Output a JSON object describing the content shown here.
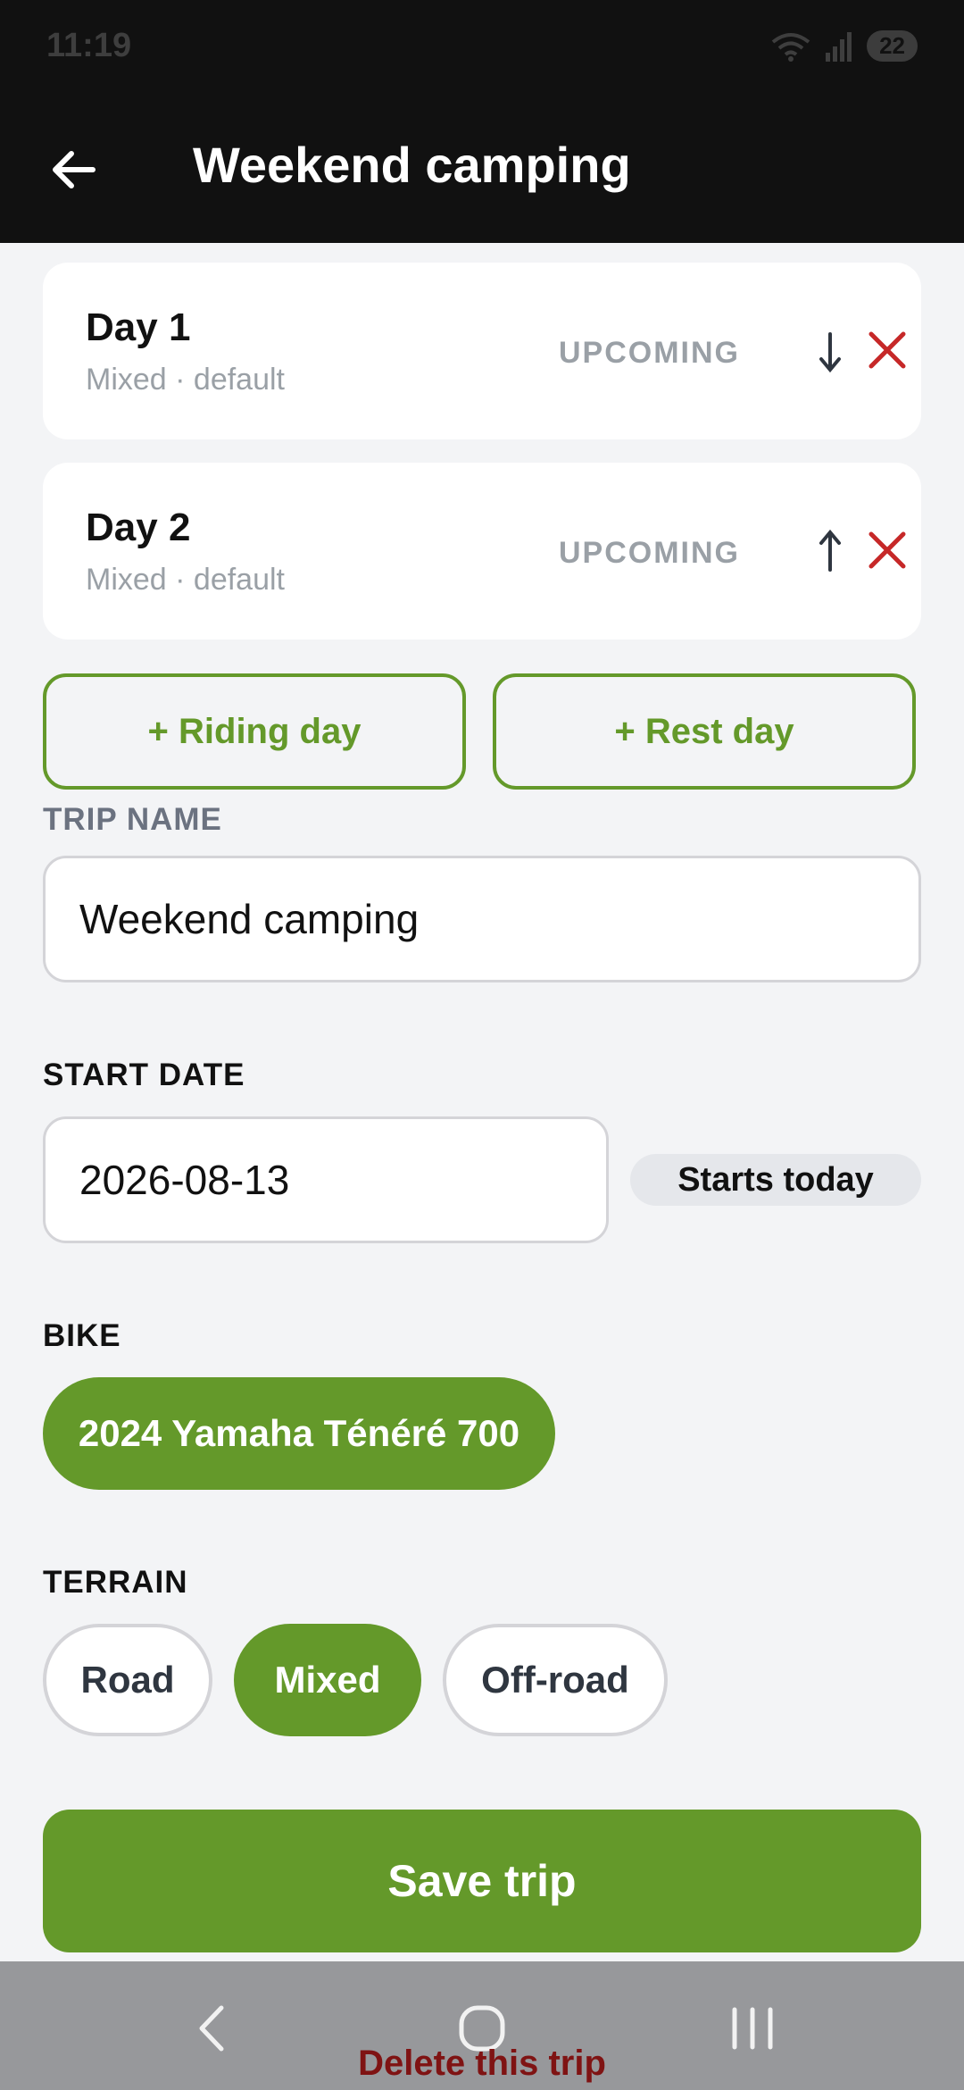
{
  "status_bar": {
    "time": "11:19",
    "battery": "22",
    "wifi_icon": "wifi-icon",
    "signal_icon": "signal-icon"
  },
  "header": {
    "title": "Weekend camping",
    "back_icon": "back-arrow-icon"
  },
  "days": [
    {
      "title": "Day 1",
      "subtitle": "Mixed · default",
      "status": "UPCOMING",
      "move_icon": "arrow-down-icon"
    },
    {
      "title": "Day 2",
      "subtitle": "Mixed · default",
      "status": "UPCOMING",
      "move_icon": "arrow-up-icon"
    }
  ],
  "add_buttons": {
    "riding_day": "+ Riding day",
    "rest_day": "+ Rest day"
  },
  "trip_name": {
    "label": "TRIP NAME",
    "value": "Weekend camping"
  },
  "start_date": {
    "label": "START DATE",
    "value": "2026-08-13",
    "badge": "Starts today"
  },
  "bike": {
    "label": "BIKE",
    "selected": "2024 Yamaha Ténéré 700"
  },
  "terrain": {
    "label": "TERRAIN",
    "options": [
      "Road",
      "Mixed",
      "Off-road"
    ],
    "selected": "Mixed"
  },
  "actions": {
    "save": "Save trip",
    "delete": "Delete this trip"
  },
  "colors": {
    "accent": "#64992a",
    "danger": "#c62828",
    "muted": "#9aa0a6",
    "header_bg": "#111111"
  }
}
